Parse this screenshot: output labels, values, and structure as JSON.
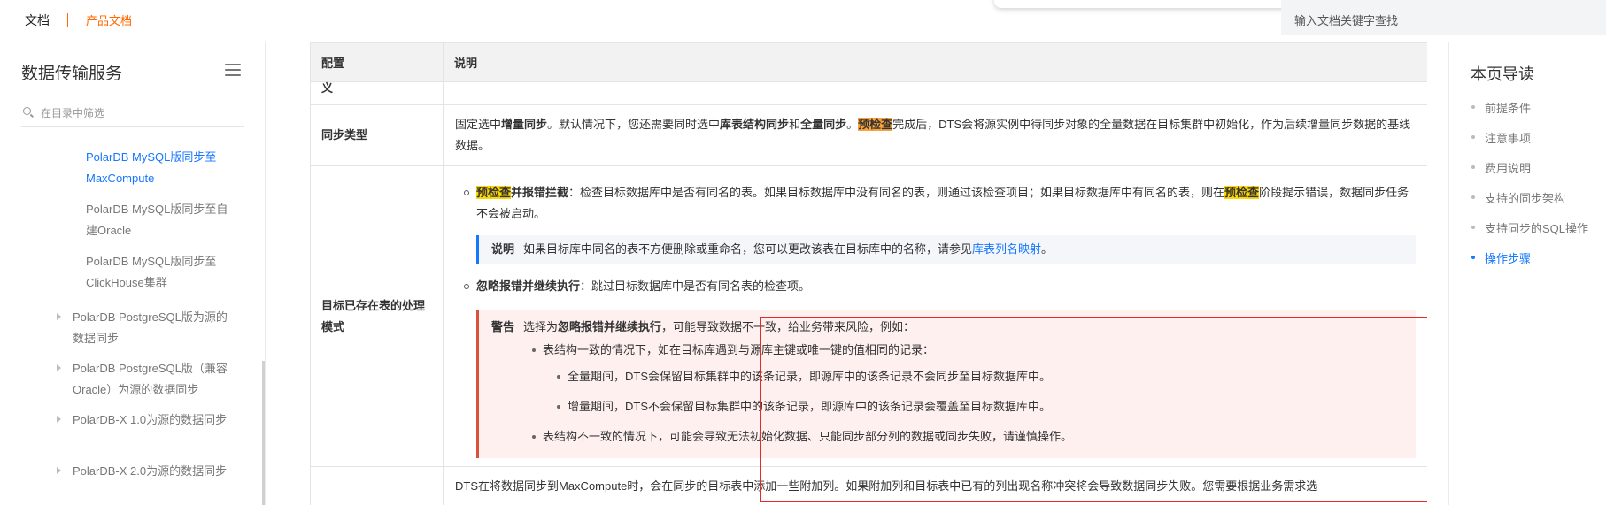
{
  "topbar": {
    "brand": "文档",
    "product": "产品文档",
    "search_placeholder": "输入文档关键字查找"
  },
  "sidebar": {
    "title": "数据传输服务",
    "filter_placeholder": "在目录中筛选",
    "items": [
      {
        "label": "PolarDB MySQL版同步至MaxCompute",
        "active": true
      },
      {
        "label": "PolarDB MySQL版同步至自建Oracle"
      },
      {
        "label": "PolarDB MySQL版同步至ClickHouse集群"
      },
      {
        "label": "PolarDB PostgreSQL版为源的数据同步"
      },
      {
        "label": "PolarDB PostgreSQL版（兼容Oracle）为源的数据同步"
      },
      {
        "label": "PolarDB-X 1.0为源的数据同步"
      },
      {
        "label": "PolarDB-X 2.0为源的数据同步"
      }
    ]
  },
  "table": {
    "header_config": "配置",
    "header_desc": "说明",
    "row0_cut_text": "义",
    "sync_type": {
      "key": "同步类型",
      "t1": "固定选中",
      "t2": "增量同步",
      "t3": "。默认情况下，您还需要同时选中",
      "t4": "库表结构同步",
      "t5": "和",
      "t6": "全量同步",
      "t7": "。",
      "t8": "预检查",
      "t9": "完成后，DTS会将源实例中待同步对象的全量数据在目标集群中初始化，作为后续增量同步数据的基线数据。"
    },
    "target_mode": {
      "key": "目标已存在表的处理模式",
      "opt1_hl": "预检查",
      "opt1_b": "并报错拦截",
      "opt1_text": "：检查目标数据库中是否有同名的表。如果目标数据库中没有同名的表，则通过该检查项目；如果目标数据库中有同名的表，则在",
      "opt1_hl2": "预检查",
      "opt1_text2": "阶段提示错误，数据同步任务不会被启动。",
      "note_label": "说明",
      "note_text": "如果目标库中同名的表不方便删除或重命名，您可以更改该表在目标库中的名称，请参见",
      "note_link": "库表列名映射",
      "note_end": "。",
      "opt2_b": "忽略报错并继续执行",
      "opt2_text": "：跳过目标数据库中是否有同名表的检查项。",
      "warn_label": "警告",
      "warn_t1": "选择为",
      "warn_b": "忽略报错并继续执行",
      "warn_t2": "，可能导致数据不一致，给业务带来风险，例如：",
      "warn_l1": "表结构一致的情况下，如在目标库遇到与源库主键或唯一键的值相同的记录：",
      "warn_l2a": "全量期间，DTS会保留目标集群中的该条记录，即源库中的该条记录不会同步至目标数据库中。",
      "warn_l2b": "增量期间，DTS不会保留目标集群中的该条记录，即源库中的该条记录会覆盖至目标数据库中。",
      "warn_l1b": "表结构不一致的情况下，可能会导致无法初始化数据、只能同步部分列的数据或同步失败，请谨慎操作。"
    },
    "last_row_text": "DTS在将数据同步到MaxCompute时，会在同步的目标表中添加一些附加列。如果附加列和目标表中已有的列出现名称冲突将会导致数据同步失败。您需要根据业务需求选"
  },
  "toc": {
    "title": "本页导读",
    "items": [
      {
        "label": "前提条件"
      },
      {
        "label": "注意事项"
      },
      {
        "label": "费用说明"
      },
      {
        "label": "支持的同步架构"
      },
      {
        "label": "支持同步的SQL操作"
      },
      {
        "label": "操作步骤",
        "active": true
      }
    ]
  },
  "colors": {
    "accent": "#1677ff",
    "brand_orange": "#ff6a00",
    "highlight_yellow": "#ffd700",
    "warn_red": "#e32b2b"
  }
}
